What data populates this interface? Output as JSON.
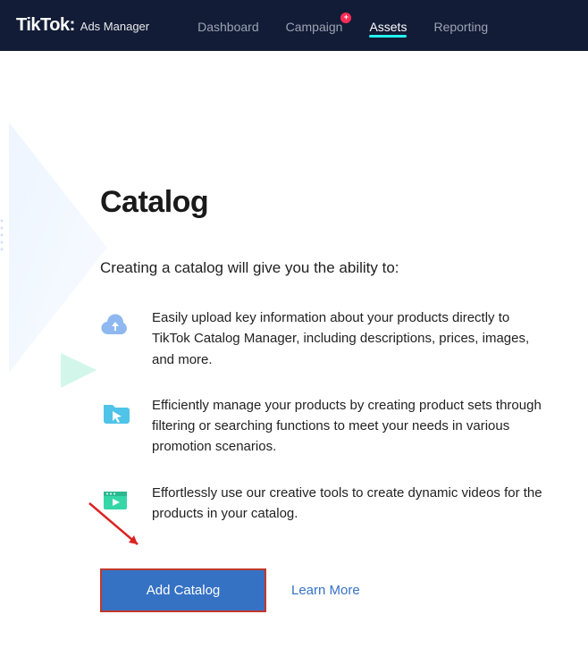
{
  "brand": {
    "logo": "TikTok:",
    "sub": "Ads Manager"
  },
  "nav": {
    "items": [
      {
        "label": "Dashboard",
        "active": false,
        "badge": null
      },
      {
        "label": "Campaign",
        "active": false,
        "badge": "+"
      },
      {
        "label": "Assets",
        "active": true,
        "badge": null
      },
      {
        "label": "Reporting",
        "active": false,
        "badge": null
      }
    ]
  },
  "page": {
    "title": "Catalog",
    "intro": "Creating a catalog will give you the ability to:"
  },
  "features": [
    {
      "icon": "cloud-upload",
      "text": "Easily upload key information about your products directly to TikTok Catalog Manager, including descriptions, prices, images, and more."
    },
    {
      "icon": "folder-pointer",
      "text": "Efficiently manage your products by creating product sets through filtering or searching functions to meet your needs in various promotion scenarios."
    },
    {
      "icon": "video-play",
      "text": "Effortlessly use our creative tools to create dynamic videos for the products in your catalog."
    }
  ],
  "actions": {
    "primary": "Add Catalog",
    "learn_more": "Learn More"
  }
}
